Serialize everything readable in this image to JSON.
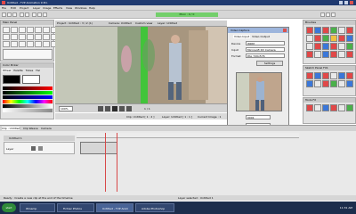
{
  "window": {
    "title": "Untitled - TVP Animation 9 Pro"
  },
  "menu": [
    "File",
    "Edit",
    "Project",
    "Layer",
    "Image",
    "Effects",
    "View",
    "Windows",
    "Help"
  ],
  "toolbar": {
    "status": "Pbox : 0 / 0"
  },
  "video_panel": {
    "tabs": [
      "Project : Untitled : 3 / 2 (1)",
      "Camera: Untitled",
      "Custom view",
      "Layer: Untitled"
    ],
    "zoom": "100%",
    "frame": "1 / 1"
  },
  "capture_dialog": {
    "title": "Video Capture",
    "tabs": [
      "Video Input",
      "Video Output"
    ],
    "fields": [
      {
        "label": "Device",
        "value": "WDM"
      },
      {
        "label": "Input",
        "value": "Microsoft DV Camera"
      },
      {
        "label": "Format",
        "value": "PAL 720x576"
      }
    ],
    "settings_button": "Settings",
    "grab_value": "0001",
    "options": [
      {
        "label": "Apply to",
        "value": "Append"
      },
      {
        "label": "Length",
        "value": "1"
      },
      {
        "label": "Step",
        "value": "1"
      }
    ]
  },
  "left_panels": {
    "tools_title": "Main Panel",
    "color_title": "Color Picker",
    "color_tabs": [
      "Wheel",
      "Palette",
      "Tubes",
      "Hsl"
    ]
  },
  "right_panels": {
    "brushes_title": "Brushes",
    "second_title": "Sketch Panel FX1",
    "third_title": "Tools FX"
  },
  "info_bar": {
    "left": "Clip: Untitled [ 1 : 2 ]",
    "mid": "Layer: Untitled [ 1 : 1 ]",
    "right": "Current Image : 1"
  },
  "timeline": {
    "tabs": [
      "Clip : Untitled",
      "Clip Weave",
      "Camera"
    ],
    "layer_name": "Untitled 1",
    "layer_label": "Layer",
    "status": "Ready : Create a new clip at the end of the timeline",
    "right_status": "Layer selected : Untitled 1"
  },
  "taskbar": {
    "start": "start",
    "tasks": [
      "Winamp",
      "Fichier Photos",
      "Untitled - TVP Anim",
      "Adobe Photoshop"
    ],
    "clock": "11:31 AM"
  },
  "colors": {
    "title": "#1f3a70",
    "taskbar": "#1c2d4c",
    "status_green": "#73cf6b"
  }
}
